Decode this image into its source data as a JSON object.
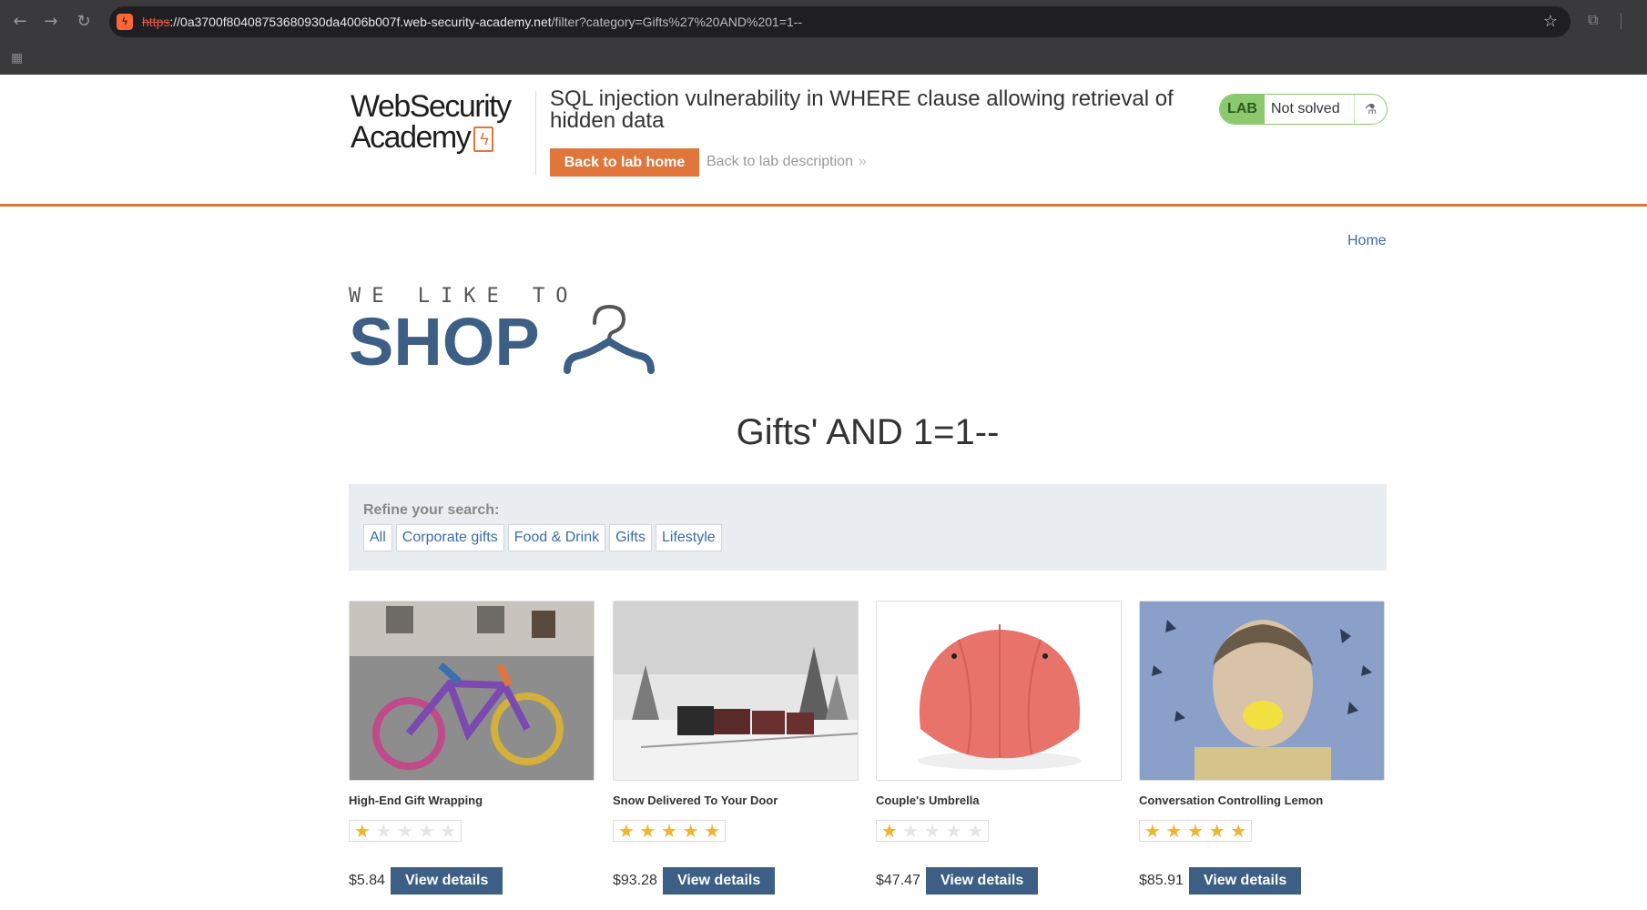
{
  "browser": {
    "url_scheme": "https",
    "url_host": "://0a3700f80408753680930da4006b007f.web-security-academy.net",
    "url_path": "/filter?category=Gifts%27%20AND%201=1--"
  },
  "academy": {
    "logo_line1": "WebSecurity",
    "logo_line2": "Academy",
    "lab_title": "SQL injection vulnerability in WHERE clause allowing retrieval of hidden data",
    "back_home": "Back to lab home",
    "back_description": "Back to lab description",
    "status_badge": "LAB",
    "status_text": "Not solved"
  },
  "shop": {
    "home_link": "Home",
    "logo_top": "WE LIKE TO",
    "logo_main": "SHOP",
    "category_title": "Gifts' AND 1=1--",
    "refine_label": "Refine your search:",
    "filters": [
      "All",
      "Corporate gifts",
      "Food & Drink",
      "Gifts",
      "Lifestyle"
    ]
  },
  "products": [
    {
      "name": "High-End Gift Wrapping",
      "rating": 1,
      "price": "$5.84",
      "button": "View details",
      "image": "yarn-bombed-bicycle"
    },
    {
      "name": "Snow Delivered To Your Door",
      "rating": 5,
      "price": "$93.28",
      "button": "View details",
      "image": "steam-train-in-snow"
    },
    {
      "name": "Couple's Umbrella",
      "rating": 1,
      "price": "$47.47",
      "button": "View details",
      "image": "red-umbrella"
    },
    {
      "name": "Conversation Controlling Lemon",
      "rating": 5,
      "price": "$85.91",
      "button": "View details",
      "image": "man-biting-lemon"
    }
  ],
  "colors": {
    "accent_orange": "#e0763b",
    "shop_blue": "#3d5f85",
    "link_blue": "#3b6aa8",
    "lab_green": "#8ac96f",
    "star_gold": "#f0b429"
  }
}
